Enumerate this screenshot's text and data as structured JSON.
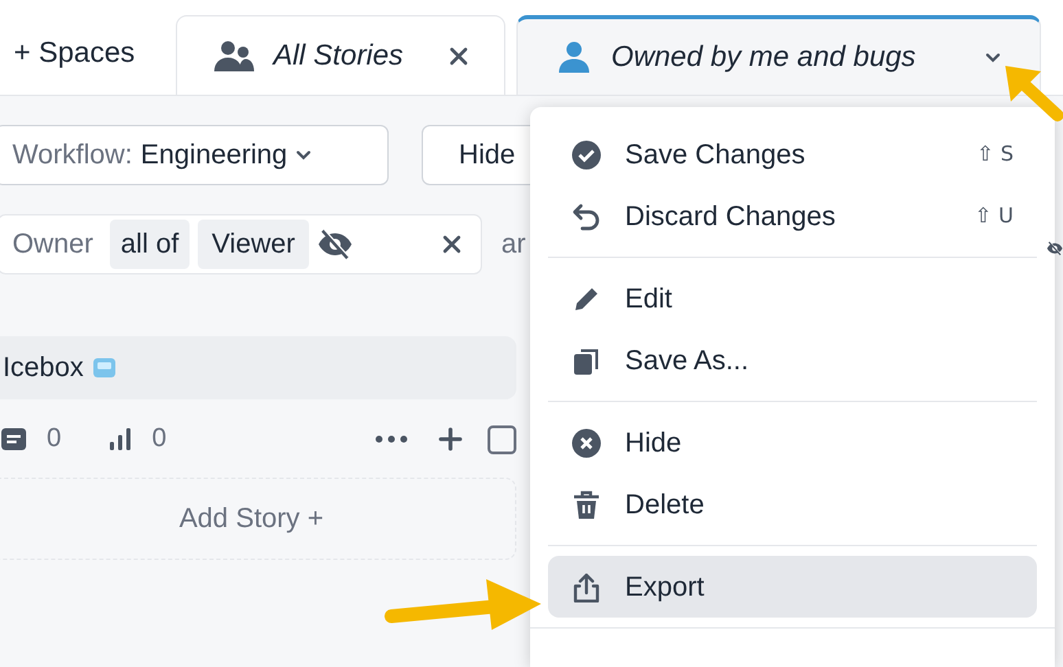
{
  "top_bar": {
    "spaces_button": "+ Spaces",
    "tabs": [
      {
        "label": "All Stories",
        "selected": false
      },
      {
        "label": "Owned by me and bugs",
        "selected": true
      }
    ]
  },
  "toolbar": {
    "workflow_label": "Workflow:",
    "workflow_value": "Engineering",
    "hide_button": "Hide"
  },
  "filter": {
    "field": "Owner",
    "operator": "all of",
    "value": "Viewer",
    "next_text": "ar"
  },
  "column": {
    "title": "Icebox",
    "stats": [
      "0",
      "0"
    ],
    "checked": false,
    "add_story": "Add Story +"
  },
  "menu": {
    "groups": [
      [
        {
          "label": "Save Changes",
          "shortcut": "⇧ S",
          "selected": false
        },
        {
          "label": "Discard Changes",
          "shortcut": "⇧ U",
          "selected": false
        }
      ],
      [
        {
          "label": "Edit",
          "selected": false
        },
        {
          "label": "Save As...",
          "selected": false
        }
      ],
      [
        {
          "label": "Hide",
          "selected": false
        },
        {
          "label": "Delete",
          "selected": false
        }
      ],
      [
        {
          "label": "Export",
          "selected": true
        }
      ]
    ]
  }
}
